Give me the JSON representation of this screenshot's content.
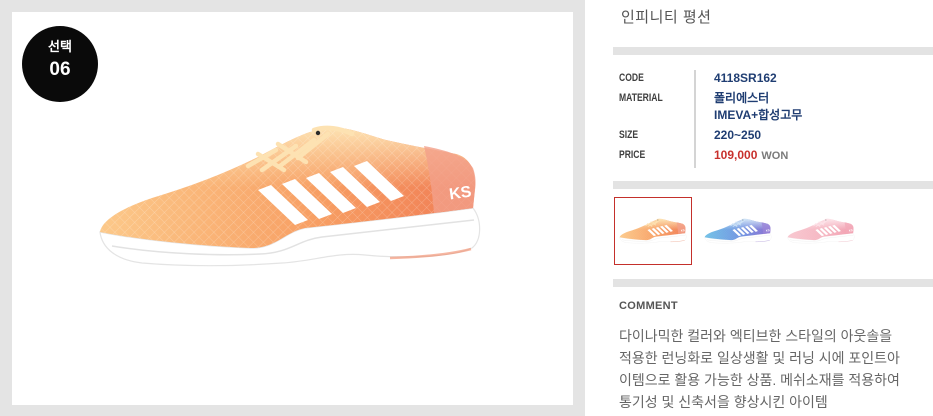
{
  "badge": {
    "label": "선택",
    "number": "06"
  },
  "product": {
    "title": "인피니티 평션",
    "logo_text": "KS"
  },
  "specs": {
    "code": {
      "label": "CODE",
      "value": "4118SR162"
    },
    "material": {
      "label": "MATERIAL",
      "values": [
        "폴리에스터",
        "IMEVA+합성고무"
      ]
    },
    "size": {
      "label": "SIZE",
      "value": "220~250"
    },
    "price": {
      "label": "PRICE",
      "value": "109,000",
      "unit": "WON"
    }
  },
  "thumbnails": [
    {
      "selected": true,
      "colors": {
        "light": "#fcc98a",
        "mid": "#f79d62",
        "dark": "#f07c55",
        "heel": "#f3a08a",
        "lace": "#fde2b2",
        "sole": "#ffffff",
        "stripe": "#ffffff"
      }
    },
    {
      "selected": false,
      "colors": {
        "light": "#6fc0e6",
        "mid": "#6f8fe0",
        "dark": "#8b6ccf",
        "heel": "#9a86d8",
        "lace": "#d0e4f6",
        "sole": "#ffffff",
        "stripe": "#ffffff"
      }
    },
    {
      "selected": false,
      "colors": {
        "light": "#f8c6cf",
        "mid": "#f5b3bf",
        "dark": "#f19cae",
        "heel": "#f3a9b8",
        "lace": "#fde3e9",
        "sole": "#ffffff",
        "stripe": "#ffffff"
      }
    }
  ],
  "comment": {
    "label": "COMMENT",
    "lines": [
      "다이나믹한 컬러와 엑티브한 스타일의 아웃솔을",
      "적용한 런닝화로 일상생활 및 러닝 시에 포인트아",
      "이템으로 활용 가능한 상품. 메쉬소재를 적용하여",
      "통기성 및 신축서을 향상시킨 아이템"
    ]
  },
  "ui_colors": {
    "frame": "#e4e4e4",
    "badge": "#0a0a0a",
    "divider": "#e3e3e3",
    "value": "#1f3d72",
    "price": "#c8312d",
    "selected": "#c4302b"
  }
}
